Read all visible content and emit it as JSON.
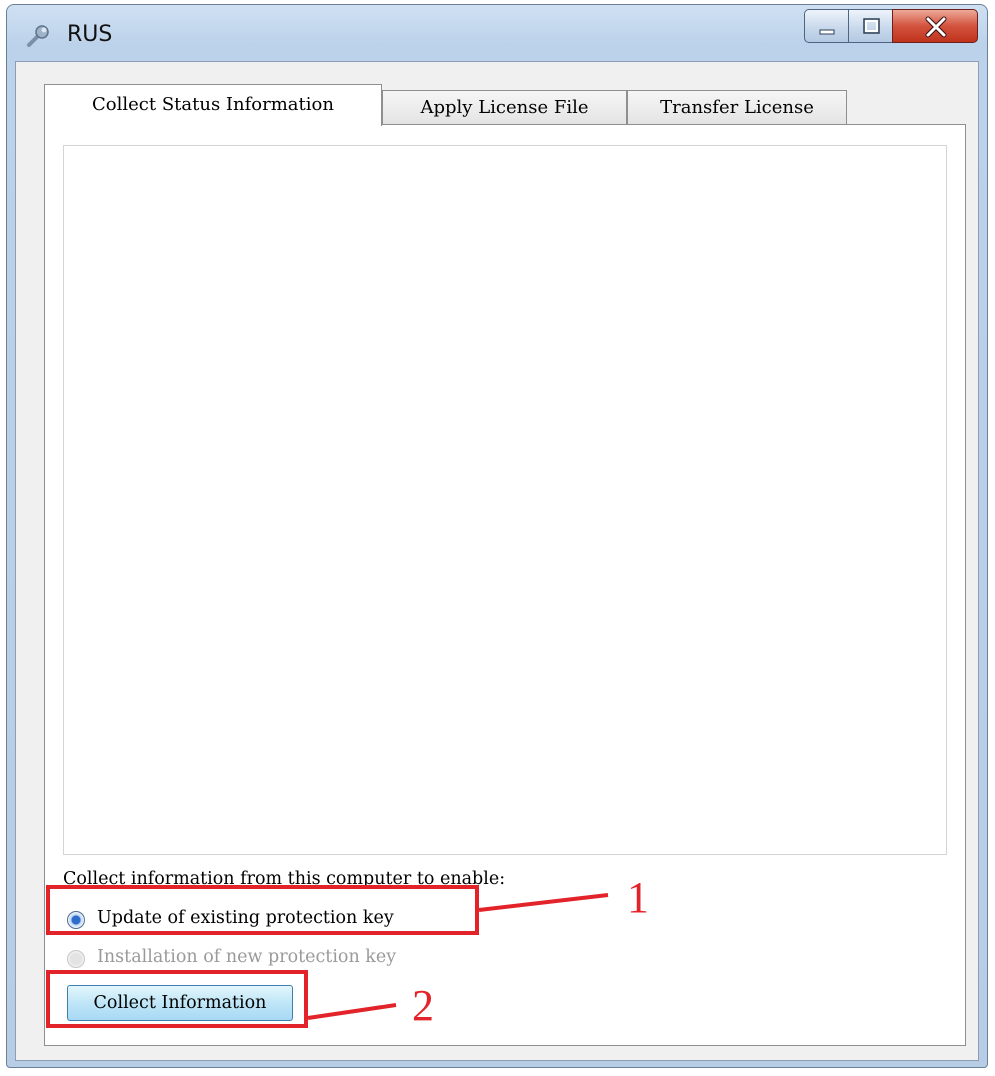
{
  "window": {
    "title": "RUS",
    "controls": [
      "minimize-icon",
      "maximize-icon",
      "close-icon"
    ]
  },
  "tabs": [
    {
      "label": "Collect Status Information",
      "active": true
    },
    {
      "label": "Apply License File",
      "active": false
    },
    {
      "label": "Transfer License",
      "active": false
    }
  ],
  "panel": {
    "status_text": "",
    "instruction": "Collect information from this computer to enable:",
    "options": [
      {
        "label": "Update of existing protection key",
        "selected": true,
        "enabled": true
      },
      {
        "label": "Installation of new protection key",
        "selected": false,
        "enabled": false
      }
    ],
    "collect_button": "Collect Information"
  },
  "annotations": {
    "step1": "1",
    "step2": "2",
    "color": "#e2232a"
  }
}
